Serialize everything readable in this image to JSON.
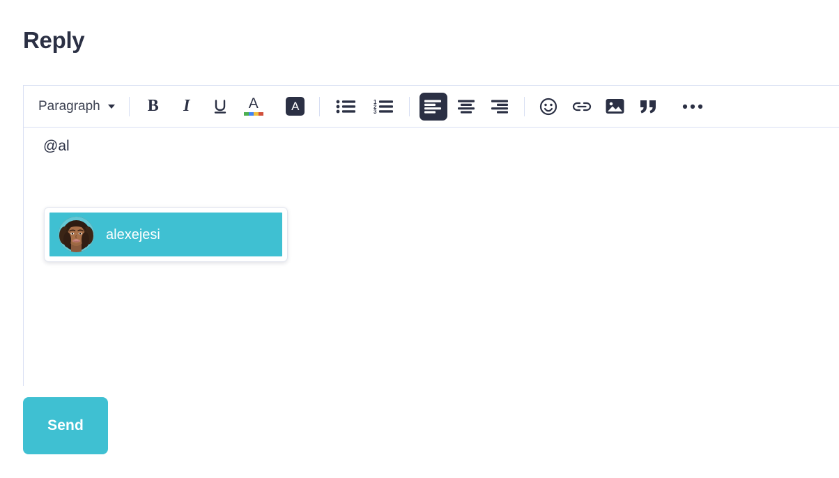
{
  "page": {
    "title": "Reply"
  },
  "colors": {
    "accent_teal": "#3fc0d2",
    "text_dark": "#2b3044",
    "border_lavender": "#d8dff3",
    "swatch_green": "#4caf50",
    "swatch_blue": "#4285f4",
    "swatch_yellow": "#f0c040",
    "swatch_red": "#d1503c"
  },
  "toolbar": {
    "block_format": {
      "label": "Paragraph",
      "caret_icon": "chevron-down-icon"
    },
    "buttons": [
      {
        "id": "bold",
        "name": "bold-button",
        "icon": "bold-icon",
        "label": "B",
        "active": false
      },
      {
        "id": "italic",
        "name": "italic-button",
        "icon": "italic-icon",
        "label": "I",
        "active": false
      },
      {
        "id": "underline",
        "name": "underline-button",
        "icon": "underline-icon",
        "label": "U",
        "active": false
      },
      {
        "id": "text_color",
        "name": "text-color-button",
        "icon": "text-color-icon",
        "label": "A",
        "active": false
      },
      {
        "id": "highlight",
        "name": "highlight-color-button",
        "icon": "highlight-icon",
        "label": "A",
        "active": false
      },
      {
        "id": "bullet_list",
        "name": "bullet-list-button",
        "icon": "bullet-list-icon",
        "label": "",
        "active": false
      },
      {
        "id": "numbered_list",
        "name": "numbered-list-button",
        "icon": "numbered-list-icon",
        "label": "",
        "active": false
      },
      {
        "id": "align_left",
        "name": "align-left-button",
        "icon": "align-left-icon",
        "label": "",
        "active": true
      },
      {
        "id": "align_center",
        "name": "align-center-button",
        "icon": "align-center-icon",
        "label": "",
        "active": false
      },
      {
        "id": "align_right",
        "name": "align-right-button",
        "icon": "align-right-icon",
        "label": "",
        "active": false
      },
      {
        "id": "emoji",
        "name": "emoji-button",
        "icon": "emoji-icon",
        "label": "",
        "active": false
      },
      {
        "id": "link",
        "name": "insert-link-button",
        "icon": "link-icon",
        "label": "",
        "active": false
      },
      {
        "id": "image",
        "name": "insert-image-button",
        "icon": "image-icon",
        "label": "",
        "active": false
      },
      {
        "id": "quote",
        "name": "blockquote-button",
        "icon": "quote-icon",
        "label": "",
        "active": false
      },
      {
        "id": "more",
        "name": "more-options-button",
        "icon": "ellipsis-icon",
        "label": "",
        "active": false
      }
    ]
  },
  "editor": {
    "content": "@al",
    "placeholder": ""
  },
  "mention_menu": {
    "visible": true,
    "query": "@al",
    "suggestions": [
      {
        "username": "alexejesi",
        "avatar": "user-photo-avatar",
        "selected": true
      }
    ]
  },
  "actions": {
    "send_label": "Send"
  }
}
